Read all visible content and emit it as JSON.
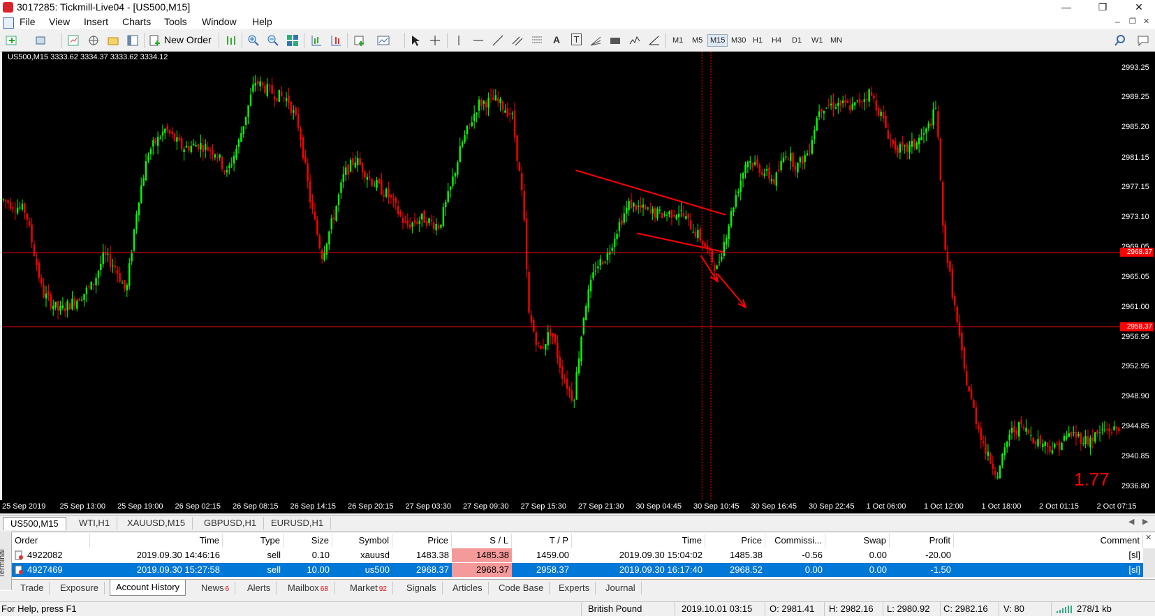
{
  "window": {
    "title": "3017285: Tickmill-Live04 - [US500,M15]",
    "controls": [
      "—",
      "❐",
      "✕"
    ]
  },
  "menu": [
    "File",
    "View",
    "Insert",
    "Charts",
    "Tools",
    "Window",
    "Help"
  ],
  "toolbar": {
    "new_order_label": "New Order",
    "timeframes": [
      "M1",
      "M5",
      "M15",
      "M30",
      "H1",
      "H4",
      "D1",
      "W1",
      "MN"
    ],
    "active_timeframe": "M15",
    "text_tool_label": "A",
    "text_label_tool_label": "T"
  },
  "chart": {
    "info": "US500,M15  3333.62 3334.37 3333.62 3334.12",
    "background": "#000000",
    "bull_color": "#00ff00",
    "bear_color": "#ff0000",
    "price_levels": [
      "2993.25",
      "2989.25",
      "2985.20",
      "2981.15",
      "2977.15",
      "2973.10",
      "2969.05",
      "2965.05",
      "2961.00",
      "2956.95",
      "2952.95",
      "2948.90",
      "2944.85",
      "2940.85",
      "2936.80"
    ],
    "price_tags": [
      "2968.37",
      "2958.37"
    ],
    "time_labels": [
      "25 Sep 2019",
      "25 Sep 13:00",
      "25 Sep 19:00",
      "26 Sep 02:15",
      "26 Sep 08:15",
      "26 Sep 14:15",
      "26 Sep 20:15",
      "27 Sep 03:30",
      "27 Sep 09:30",
      "27 Sep 15:30",
      "27 Sep 21:30",
      "30 Sep 04:45",
      "30 Sep 10:45",
      "30 Sep 16:45",
      "30 Sep 22:45",
      "1 Oct 06:00",
      "1 Oct 12:00",
      "1 Oct 18:00",
      "2 Oct 01:15",
      "2 Oct 07:15"
    ],
    "overlay_number": "1.77"
  },
  "chart_data": {
    "type": "candlestick",
    "title": "US500,M15",
    "ylim": [
      2935.0,
      2995.5
    ],
    "horizontal_lines": [
      2968.37,
      2958.37
    ],
    "close_path": [
      [
        0,
        2975.5
      ],
      [
        0.02,
        2974.0
      ],
      [
        0.035,
        2963.0
      ],
      [
        0.05,
        2960.5
      ],
      [
        0.065,
        2962.0
      ],
      [
        0.08,
        2964.0
      ],
      [
        0.09,
        2968.0
      ],
      [
        0.1,
        2966.5
      ],
      [
        0.11,
        2963.0
      ],
      [
        0.12,
        2975.0
      ],
      [
        0.13,
        2982.0
      ],
      [
        0.145,
        2985.0
      ],
      [
        0.16,
        2982.5
      ],
      [
        0.175,
        2983.0
      ],
      [
        0.19,
        2982.0
      ],
      [
        0.2,
        2979.0
      ],
      [
        0.21,
        2983.0
      ],
      [
        0.225,
        2991.5
      ],
      [
        0.24,
        2990.0
      ],
      [
        0.255,
        2989.0
      ],
      [
        0.265,
        2985.0
      ],
      [
        0.275,
        2975.0
      ],
      [
        0.285,
        2968.0
      ],
      [
        0.295,
        2973.0
      ],
      [
        0.305,
        2979.0
      ],
      [
        0.315,
        2981.0
      ],
      [
        0.33,
        2978.0
      ],
      [
        0.345,
        2976.0
      ],
      [
        0.36,
        2972.0
      ],
      [
        0.375,
        2973.0
      ],
      [
        0.39,
        2972.0
      ],
      [
        0.4,
        2977.0
      ],
      [
        0.41,
        2983.0
      ],
      [
        0.425,
        2988.5
      ],
      [
        0.44,
        2989.0
      ],
      [
        0.455,
        2987.0
      ],
      [
        0.465,
        2975.0
      ],
      [
        0.47,
        2960.0
      ],
      [
        0.48,
        2955.0
      ],
      [
        0.49,
        2958.0
      ],
      [
        0.5,
        2952.0
      ],
      [
        0.51,
        2948.5
      ],
      [
        0.52,
        2961.0
      ],
      [
        0.53,
        2966.5
      ],
      [
        0.54,
        2968.0
      ],
      [
        0.55,
        2972.0
      ],
      [
        0.56,
        2975.0
      ],
      [
        0.575,
        2974.0
      ],
      [
        0.59,
        2973.5
      ],
      [
        0.605,
        2974.0
      ],
      [
        0.615,
        2972.0
      ],
      [
        0.625,
        2970.0
      ],
      [
        0.632,
        2968.0
      ],
      [
        0.638,
        2966.0
      ],
      [
        0.645,
        2970.0
      ],
      [
        0.655,
        2976.0
      ],
      [
        0.665,
        2981.0
      ],
      [
        0.675,
        2980.0
      ],
      [
        0.69,
        2978.0
      ],
      [
        0.7,
        2982.0
      ],
      [
        0.71,
        2980.0
      ],
      [
        0.72,
        2982.0
      ],
      [
        0.73,
        2988.0
      ],
      [
        0.745,
        2988.5
      ],
      [
        0.76,
        2988.0
      ],
      [
        0.775,
        2990.0
      ],
      [
        0.785,
        2987.0
      ],
      [
        0.795,
        2983.0
      ],
      [
        0.805,
        2982.0
      ],
      [
        0.815,
        2983.0
      ],
      [
        0.825,
        2984.5
      ],
      [
        0.835,
        2988.0
      ],
      [
        0.84,
        2972.0
      ],
      [
        0.85,
        2962.0
      ],
      [
        0.86,
        2952.0
      ],
      [
        0.87,
        2946.0
      ],
      [
        0.88,
        2941.0
      ],
      [
        0.89,
        2938.5
      ],
      [
        0.9,
        2944.0
      ],
      [
        0.91,
        2945.0
      ],
      [
        0.925,
        2943.0
      ],
      [
        0.94,
        2942.0
      ],
      [
        0.955,
        2944.0
      ],
      [
        0.97,
        2943.0
      ],
      [
        0.985,
        2944.5
      ]
    ],
    "drawn_objects": [
      {
        "type": "trendline",
        "points": [
          [
            0.513,
            2979.5
          ],
          [
            0.647,
            2973.5
          ]
        ]
      },
      {
        "type": "trendline",
        "points": [
          [
            0.568,
            2971.0
          ],
          [
            0.645,
            2968.5
          ]
        ]
      },
      {
        "type": "arrow",
        "points": [
          [
            0.64,
            2965.5
          ],
          [
            0.665,
            2961.0
          ]
        ]
      },
      {
        "type": "arrow",
        "points": [
          [
            0.625,
            2968.0
          ],
          [
            0.64,
            2964.5
          ]
        ]
      }
    ]
  },
  "chart_tabs": [
    "US500,M15",
    "WTI,H1",
    "XAUUSD,M15",
    "GBPUSD,H1",
    "EURUSD,H1"
  ],
  "terminal": {
    "side_label": "Terminal",
    "columns": [
      "Order",
      "Time",
      "Type",
      "Size",
      "Symbol",
      "Price",
      "S / L",
      "T / P",
      "Time",
      "Price",
      "Commissi...",
      "Swap",
      "Profit",
      "Comment"
    ],
    "rows": [
      {
        "order": "4922082",
        "time": "2019.09.30 14:46:16",
        "type": "sell",
        "size": "0.10",
        "symbol": "xauusd",
        "price": "1483.38",
        "sl": "1485.38",
        "tp": "1459.00",
        "close_time": "2019.09.30 15:04:02",
        "close_price": "1485.38",
        "commission": "-0.56",
        "swap": "0.00",
        "profit": "-20.00",
        "comment": "[sl]"
      },
      {
        "order": "4927469",
        "time": "2019.09.30 15:27:58",
        "type": "sell",
        "size": "10.00",
        "symbol": "us500",
        "price": "2968.37",
        "sl": "2968.37",
        "tp": "2958.37",
        "close_time": "2019.09.30 16:17:40",
        "close_price": "2968.52",
        "commission": "0.00",
        "swap": "0.00",
        "profit": "-1.50",
        "comment": "[sl]"
      }
    ],
    "selected_row_color": "#0078d7",
    "tabs": [
      {
        "label": "Trade",
        "badge": ""
      },
      {
        "label": "Exposure",
        "badge": ""
      },
      {
        "label": "Account History",
        "badge": ""
      },
      {
        "label": "News",
        "badge": "6"
      },
      {
        "label": "Alerts",
        "badge": ""
      },
      {
        "label": "Mailbox",
        "badge": "68"
      },
      {
        "label": "Market",
        "badge": "92"
      },
      {
        "label": "Signals",
        "badge": ""
      },
      {
        "label": "Articles",
        "badge": ""
      },
      {
        "label": "Code Base",
        "badge": ""
      },
      {
        "label": "Experts",
        "badge": ""
      },
      {
        "label": "Journal",
        "badge": ""
      }
    ],
    "active_tab": "Account History"
  },
  "status": {
    "help": "For Help, press F1",
    "profile": "British Pound",
    "datetime": "2019.10.01 03:15",
    "open": "O: 2981.41",
    "high": "H: 2982.16",
    "low": "L: 2980.92",
    "close": "C: 2982.16",
    "volume": "V: 80",
    "traffic": "278/1 kb"
  }
}
